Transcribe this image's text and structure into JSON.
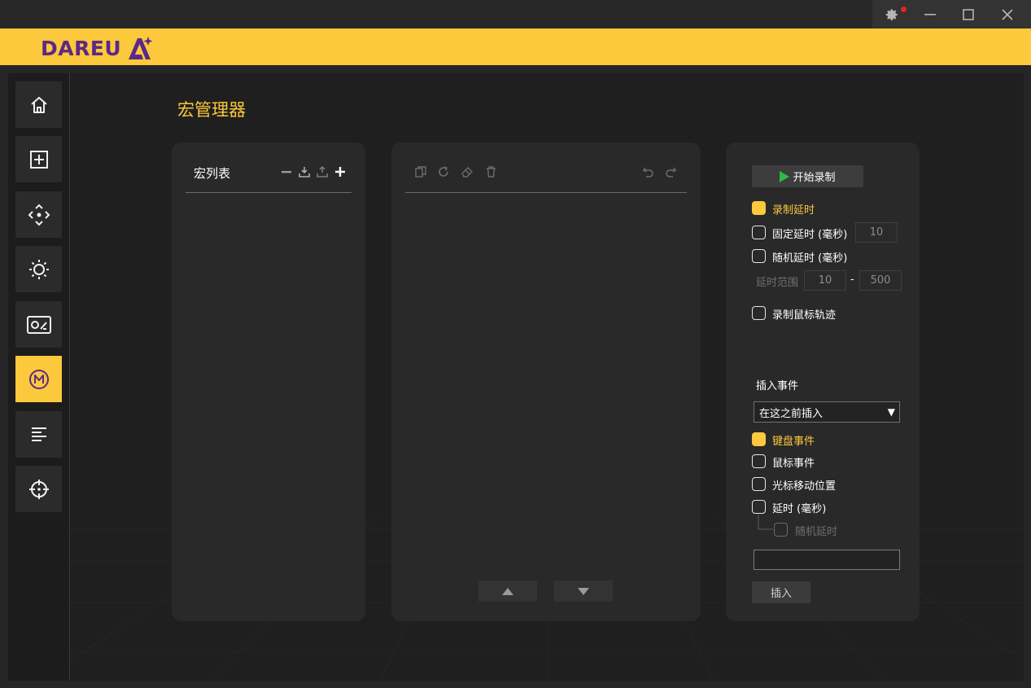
{
  "colors": {
    "accent": "#fcc83c",
    "brand_purple": "#5b2a86",
    "record_green": "#2db84a",
    "notification_red": "#e62323"
  },
  "brand": {
    "name": "DAREU"
  },
  "window_controls": {
    "icons": [
      "gear-icon",
      "minimize-icon",
      "maximize-icon",
      "close-icon"
    ]
  },
  "sidebar": {
    "items": [
      {
        "icon": "home-icon",
        "active": false
      },
      {
        "icon": "add-box-icon",
        "active": false
      },
      {
        "icon": "move-arrows-icon",
        "active": false
      },
      {
        "icon": "brightness-icon",
        "active": false
      },
      {
        "icon": "performance-icon",
        "active": false
      },
      {
        "icon": "macro-icon",
        "glyph": "M",
        "active": true
      },
      {
        "icon": "text-align-icon",
        "active": false
      },
      {
        "icon": "crosshair-icon",
        "active": false
      }
    ]
  },
  "page": {
    "title": "宏管理器"
  },
  "macro_list": {
    "title": "宏列表",
    "toolbar_icons": [
      "remove-icon",
      "import-icon",
      "export-icon",
      "add-icon"
    ]
  },
  "editor": {
    "toolbar_left_icons": [
      "copy-icon",
      "redo-loop-icon",
      "eraser-icon",
      "trash-icon"
    ],
    "toolbar_right_icons": [
      "undo-icon",
      "redo-icon"
    ],
    "move_buttons": [
      "move-up-icon",
      "move-down-icon"
    ]
  },
  "recording": {
    "start_label": "开始录制",
    "record_delay": {
      "label": "录制延时",
      "checked": true
    },
    "fixed_delay": {
      "label": "固定延时 (毫秒)",
      "checked": false,
      "value": "10"
    },
    "random_delay": {
      "label": "随机延时 (毫秒)",
      "checked": false
    },
    "delay_range": {
      "label": "延时范围",
      "min": "10",
      "separator": "-",
      "max": "500"
    },
    "record_mouse": {
      "label": "录制鼠标轨迹",
      "checked": false
    }
  },
  "insert": {
    "section_label": "插入事件",
    "position_select": "在这之前插入",
    "options": [
      {
        "label": "键盘事件",
        "checked": true
      },
      {
        "label": "鼠标事件",
        "checked": false
      },
      {
        "label": "光标移动位置",
        "checked": false
      },
      {
        "label": "延时 (毫秒)",
        "checked": false
      }
    ],
    "random_delay": {
      "label": "随机延时",
      "checked": false
    },
    "value": "",
    "button_label": "插入"
  }
}
